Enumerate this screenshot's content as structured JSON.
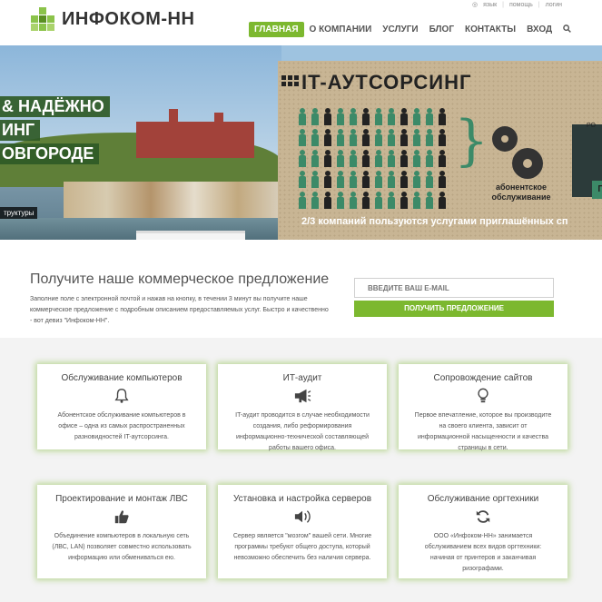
{
  "utility": {
    "language": "язык",
    "help": "помощь",
    "login": "логин"
  },
  "brand": {
    "name": "ИНФОКОМ-НН",
    "accent": "#7cb82f"
  },
  "nav": {
    "items": [
      {
        "label": "ГЛАВНАЯ",
        "active": true
      },
      {
        "label": "О КОМПАНИИ",
        "active": false
      },
      {
        "label": "УСЛУГИ",
        "active": false
      },
      {
        "label": "БЛОГ",
        "active": false
      },
      {
        "label": "КОНТАКТЫ",
        "active": false
      },
      {
        "label": "ВХОД",
        "active": false
      }
    ],
    "search_icon": "search-icon"
  },
  "hero": {
    "caption_lines": [
      "& НАДЁЖНО",
      "ИНГ",
      "ОВГОРОДЕ"
    ],
    "small_caption": "труктуры",
    "board_title": "IT-АУТСОРСИНГ",
    "board_gear_label": "абонентское обслуживание",
    "board_panel_label": "РО",
    "board_panel_button": "П",
    "board_bottom": "2/3 компаний пользуются услугами приглашённых сп",
    "slides": 2,
    "active_slide": 1
  },
  "offer": {
    "title": "Получите наше коммерческое предложение",
    "text": "Заполние поле с электронной почтой и нажав на кнопку, в течении 3 минут вы получите наше коммерческое предложение с подробным описанием предоставляемых услуг. Быстро и качественно - вот девиз \"Инфоком-НН\".",
    "email_placeholder": "ВВЕДИТЕ ВАШ E-MAIL",
    "button": "ПОЛУЧИТЬ ПРЕДЛОЖЕНИЕ"
  },
  "services": [
    {
      "title": "Обслуживание компьютеров",
      "icon": "bell-icon",
      "text": "Абонентское обслуживание компьютеров в офисе – одна из самых распространенных разновидностей IT-аутсорсинга."
    },
    {
      "title": "ИТ-аудит",
      "icon": "megaphone-icon",
      "text": "IT-аудит проводится в случае необходимости создания, либо реформирования информационно-технической составляющей работы вашего офиса."
    },
    {
      "title": "Сопровождение сайтов",
      "icon": "lightbulb-icon",
      "text": "Первое впечатление, которое вы производите на своего клиента, зависит от информационной насыщенности и качества страницы в сети."
    },
    {
      "title": "Проектирование и монтаж ЛВС",
      "icon": "thumbs-up-icon",
      "text": "Объединение компьютеров в локальную сеть (ЛВС, LAN) позволяет совместно использовать информацию или обмениваться ею."
    },
    {
      "title": "Установка и настройка серверов",
      "icon": "speaker-icon",
      "text": "Сервер является \"мозгом\" вашей сети. Многие программы требуют общего доступа, который невозможно обеспечить без наличия сервера."
    },
    {
      "title": "Обслуживание оргтехники",
      "icon": "refresh-icon",
      "text": "ООО «Инфоком-НН» занимается обслуживанием всех видов оргтехники: начиная от принтеров и заканчивая ризографами."
    }
  ]
}
